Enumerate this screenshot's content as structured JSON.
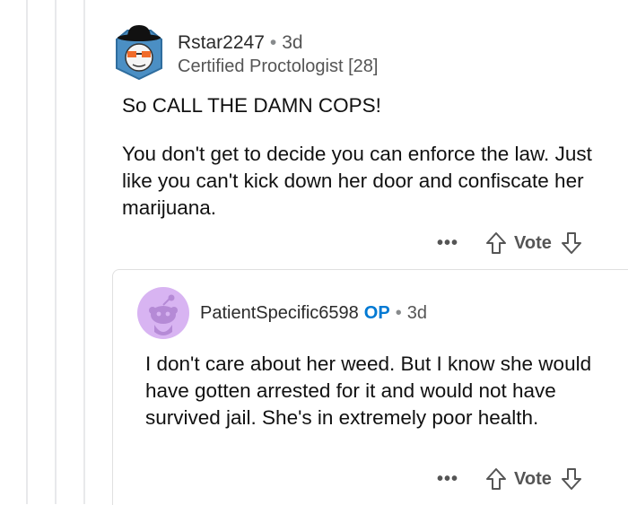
{
  "comment": {
    "author": "Rstar2247",
    "separator": "•",
    "age": "3d",
    "flair": "Certified Proctologist [28]",
    "paragraphs": [
      "So CALL THE DAMN COPS!",
      "You don't get to decide you can enforce the law. Just like you can't kick down her door and confiscate her marijuana."
    ],
    "actions": {
      "more": "•••",
      "vote": "Vote"
    }
  },
  "reply": {
    "author": "PatientSpecific6598",
    "op_badge": "OP",
    "separator": "•",
    "age": "3d",
    "text": "I don't care about her weed. But I know she would have gotten arrested for it and would not have survived jail. She's in extremely poor health.",
    "actions": {
      "more": "•••",
      "vote": "Vote"
    }
  },
  "colors": {
    "op_badge": "#0079d3",
    "avatar2_bg": "#d8b4f2",
    "text": "#1a1a1b",
    "muted": "#555555"
  }
}
